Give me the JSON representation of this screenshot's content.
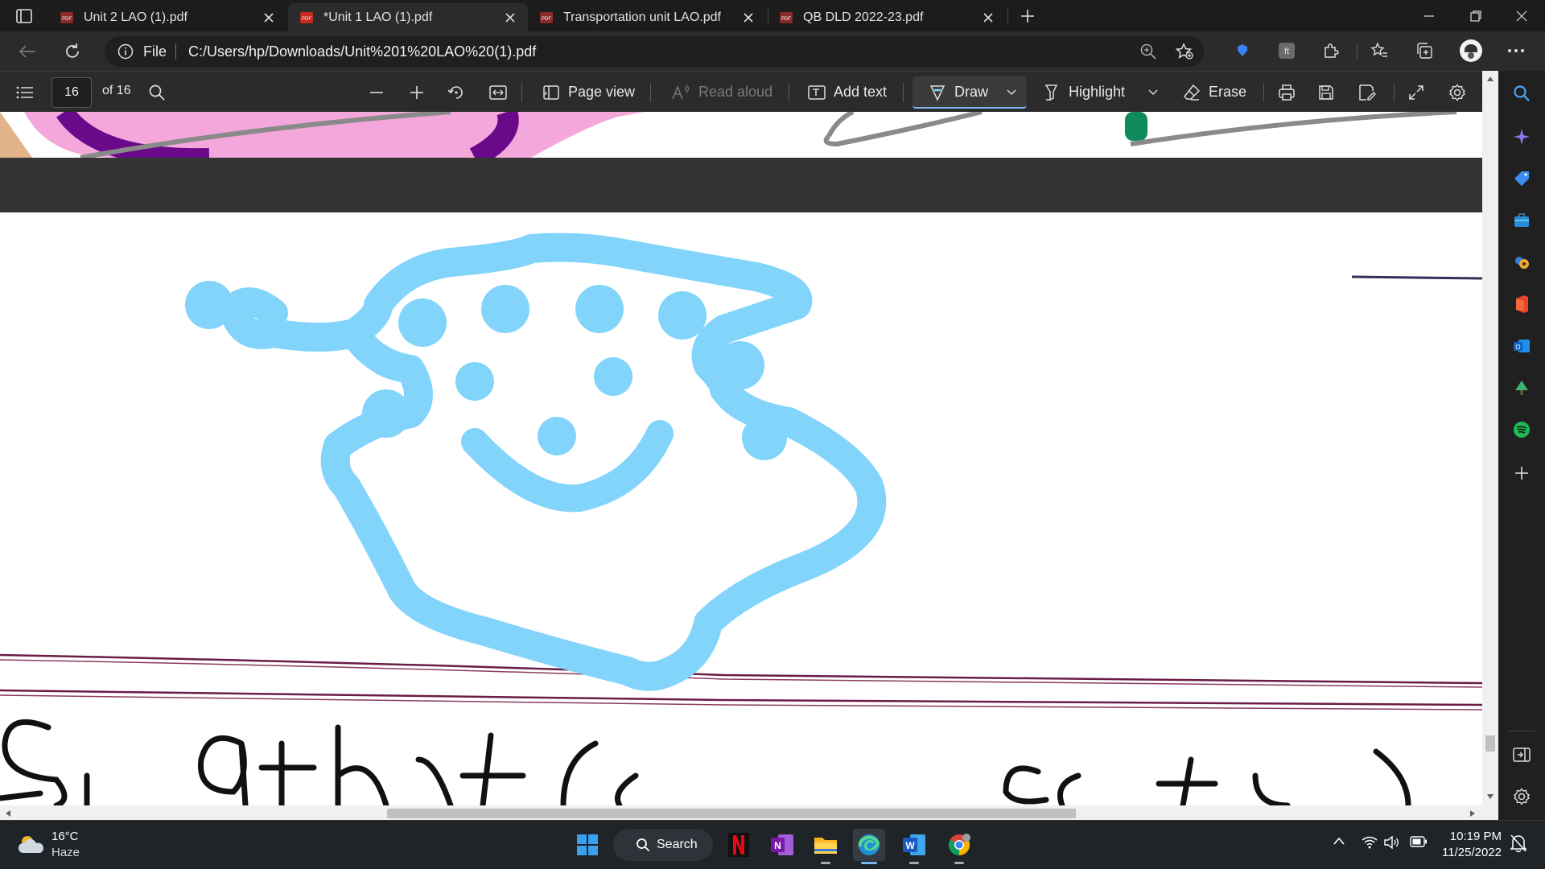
{
  "tabs": [
    {
      "title": "Unit 2 LAO (1).pdf",
      "active": false
    },
    {
      "title": "*Unit 1 LAO (1).pdf",
      "active": true
    },
    {
      "title": "Transportation unit LAO.pdf",
      "active": false
    },
    {
      "title": "QB DLD 2022-23.pdf",
      "active": false
    }
  ],
  "address": {
    "scheme_label": "File",
    "url": "C:/Users/hp/Downloads/Unit%201%20LAO%20(1).pdf"
  },
  "pdf_toolbar": {
    "page_number": "16",
    "page_total": "of 16",
    "page_view": "Page view",
    "read_aloud": "Read aloud",
    "add_text": "Add text",
    "draw": "Draw",
    "highlight": "Highlight",
    "erase": "Erase"
  },
  "drawing": {
    "ink_color": "#82d4fb",
    "underline_color": "#6a1c46"
  },
  "taskbar": {
    "weather_temp": "16°C",
    "weather_cond": "Haze",
    "search_label": "Search",
    "time": "10:19 PM",
    "date": "11/25/2022"
  },
  "colors": {
    "accent": "#7cb6f0",
    "pdf_red": "#c42b1c"
  }
}
